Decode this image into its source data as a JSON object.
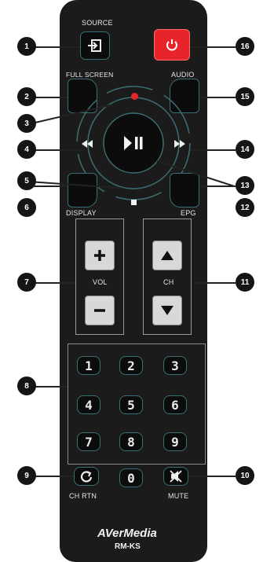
{
  "labels": {
    "source": "SOURCE",
    "full_screen": "FULL SCREEN",
    "audio": "AUDIO",
    "display": "DISPLAY",
    "epg": "EPG",
    "vol": "VOL",
    "ch": "CH",
    "ch_rtn": "CH RTN",
    "mute": "MUTE"
  },
  "keypad": [
    "1",
    "2",
    "3",
    "4",
    "5",
    "6",
    "7",
    "8",
    "9",
    "0"
  ],
  "callouts": [
    "1",
    "2",
    "3",
    "4",
    "5",
    "6",
    "7",
    "8",
    "9",
    "10",
    "11",
    "12",
    "13",
    "14",
    "15",
    "16"
  ],
  "brand": "AVerMedia",
  "model": "RM-KS",
  "colors": {
    "power": "#e8242b",
    "remote_body": "#1b1b1b",
    "button_border": "#3a6f73",
    "record_dot": "#e8242b"
  },
  "icons": {
    "source": "source-input-icon",
    "power": "power-icon",
    "record": "record-dot-icon",
    "rewind": "rewind-icon",
    "fast_forward": "fast-forward-icon",
    "play_pause": "play-pause-icon",
    "stop": "stop-icon",
    "vol_up": "plus-icon",
    "vol_down": "minus-icon",
    "ch_up": "triangle-up-icon",
    "ch_down": "triangle-down-icon",
    "ch_rtn": "return-arrow-icon",
    "mute": "mute-icon"
  }
}
